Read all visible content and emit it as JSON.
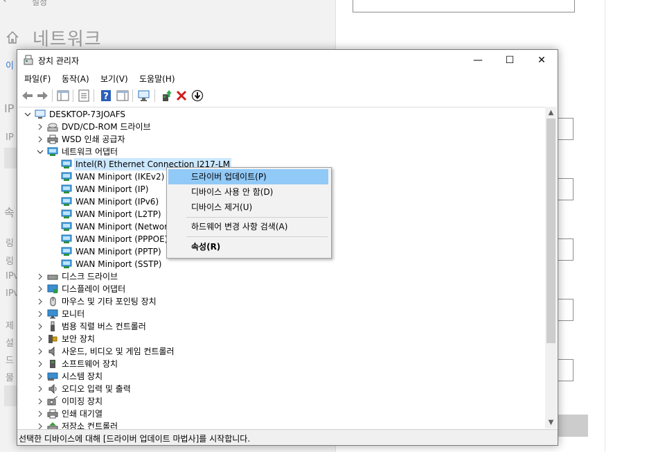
{
  "background": {
    "category": "설정",
    "page_title": "네트워크",
    "fragments": [
      "이",
      "IP",
      "IP",
      "속",
      "링",
      "링",
      "IPv",
      "IPv",
      "제",
      "설",
      "드",
      "물"
    ]
  },
  "window": {
    "title": "장치 관리자",
    "controls": {
      "minimize": "—",
      "maximize": "☐",
      "close": "✕"
    }
  },
  "menu": [
    "파일(F)",
    "동작(A)",
    "보기(V)",
    "도움말(H)"
  ],
  "tree": {
    "root": "DESKTOP-73JOAFS",
    "categories_before": [
      {
        "label": "DVD/CD-ROM 드라이브",
        "icon": "dvd-drive-icon"
      },
      {
        "label": "WSD 인쇄 공급자",
        "icon": "printer-icon"
      }
    ],
    "network": {
      "label": "네트워크 어댑터",
      "children": [
        "Intel(R) Ethernet Connection I217-LM",
        "WAN Miniport (IKEv2)",
        "WAN Miniport (IP)",
        "WAN Miniport (IPv6)",
        "WAN Miniport (L2TP)",
        "WAN Miniport (Network",
        "WAN Miniport (PPPOE)",
        "WAN Miniport (PPTP)",
        "WAN Miniport (SSTP)"
      ]
    },
    "categories_after": [
      {
        "label": "디스크 드라이브",
        "icon": "disk-drive-icon"
      },
      {
        "label": "디스플레이 어댑터",
        "icon": "display-adapter-icon"
      },
      {
        "label": "마우스 및 기타 포인팅 장치",
        "icon": "mouse-icon"
      },
      {
        "label": "모니터",
        "icon": "monitor-icon"
      },
      {
        "label": "범용 직렬 버스 컨트롤러",
        "icon": "usb-icon"
      },
      {
        "label": "보안 장치",
        "icon": "security-device-icon"
      },
      {
        "label": "사운드, 비디오 및 게임 컨트롤러",
        "icon": "speaker-icon"
      },
      {
        "label": "소프트웨어 장치",
        "icon": "software-device-icon"
      },
      {
        "label": "시스템 장치",
        "icon": "system-device-icon"
      },
      {
        "label": "오디오 입력 및 출력",
        "icon": "audio-icon"
      },
      {
        "label": "이미징 장치",
        "icon": "camera-icon"
      },
      {
        "label": "인쇄 대기열",
        "icon": "print-queue-icon"
      },
      {
        "label": "저장소 컨트롤러",
        "icon": "storage-controller-icon"
      }
    ]
  },
  "context_menu": {
    "items": [
      {
        "label": "드라이버 업데이트(P)",
        "highlighted": true
      },
      {
        "label": "디바이스 사용 안 함(D)"
      },
      {
        "label": "디바이스 제거(U)"
      },
      {
        "label": "하드웨어 변경 사항 검색(A)"
      },
      {
        "label": "속성(R)",
        "bold": true
      }
    ]
  },
  "status": "선택한 디바이스에 대해 [드라이버 업데이트 마법사]를 시작합니다.",
  "colors": {
    "selection": "#cce8ff",
    "menu_highlight": "#91c9f7",
    "network_icon": "#1f8dd6"
  }
}
